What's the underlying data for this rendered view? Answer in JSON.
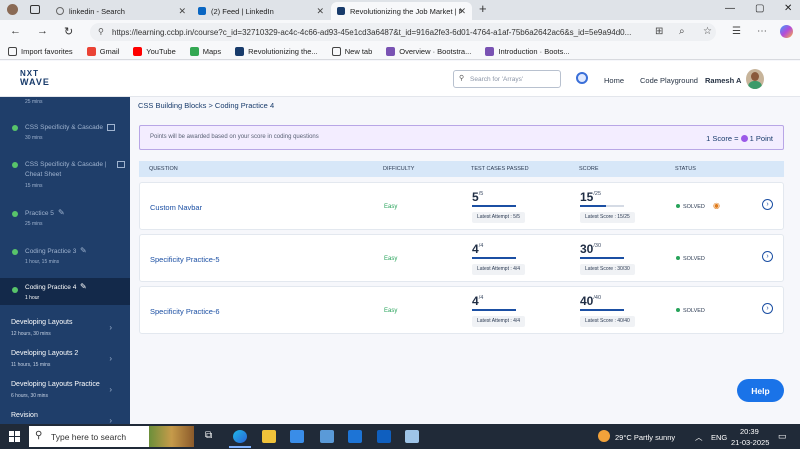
{
  "browser": {
    "tabs": [
      {
        "label": "linkedin - Search"
      },
      {
        "label": "(2) Feed | LinkedIn"
      },
      {
        "label": "Revolutionizing the Job Market | N"
      }
    ],
    "new_tab": "+",
    "url": "https://learning.ccbp.in/course?c_id=32710329-ac4c-4c66-ad93-45e1cd3a6487&t_id=916a2fe3-6d01-4764-a1af-75b6a2642ac6&s_id=5e9a94d0...",
    "bookmarks": [
      {
        "label": "Import favorites"
      },
      {
        "label": "Gmail"
      },
      {
        "label": "YouTube"
      },
      {
        "label": "Maps"
      },
      {
        "label": "Revolutionizing the..."
      },
      {
        "label": "New tab"
      },
      {
        "label": "Overview · Bootstra..."
      },
      {
        "label": "Introduction · Boots..."
      }
    ]
  },
  "header": {
    "logo_top": "NXT",
    "logo_bottom": "WAVE",
    "search_placeholder": "Search for 'Arrays'",
    "nav": {
      "home": "Home",
      "playground": "Code Playground",
      "user": "Ramesh A"
    }
  },
  "sidebar": {
    "items": [
      {
        "title": "",
        "time": "25 mins"
      },
      {
        "title": "CSS Specificity & Cascade",
        "time": "30 mins"
      },
      {
        "title": "CSS Specificity & Cascade | Cheat Sheet",
        "time": "15 mins"
      },
      {
        "title": "Practice 5",
        "time": "25 mins"
      },
      {
        "title": "Coding Practice 3",
        "time": "1 hour, 15 mins"
      },
      {
        "title": "Coding Practice 4",
        "time": "1 hour"
      }
    ],
    "sections": [
      {
        "title": "Developing Layouts",
        "time": "12 hours, 30 mins"
      },
      {
        "title": "Developing Layouts 2",
        "time": "11 hours, 15 mins"
      },
      {
        "title": "Developing Layouts Practice",
        "time": "6 hours, 30 mins"
      },
      {
        "title": "Revision",
        "time": ""
      }
    ]
  },
  "main": {
    "breadcrumb": "CSS Building Blocks > Coding Practice 4",
    "notice": "Points will be awarded based on your score in coding questions",
    "score_rule_left": "1 Score =",
    "score_rule_right": "1 Point",
    "columns": {
      "question": "QUESTION",
      "difficulty": "DIFFICULTY",
      "tests": "TEST CASES PASSED",
      "score": "SCORE",
      "status": "STATUS"
    },
    "rows": [
      {
        "question": "Custom Navbar",
        "difficulty": "Easy",
        "passed": "5",
        "total": "/5",
        "attempt": "Latest Attempt : 5/5",
        "score": "15",
        "score_total": "/25",
        "score_label": "Latest Score : 15/25",
        "score_fraction": 0.6,
        "status": "SOLVED"
      },
      {
        "question": "Specificity Practice-5",
        "difficulty": "Easy",
        "passed": "4",
        "total": "/4",
        "attempt": "Latest Attempt : 4/4",
        "score": "30",
        "score_total": "/30",
        "score_label": "Latest Score : 30/30",
        "score_fraction": 1.0,
        "status": "SOLVED"
      },
      {
        "question": "Specificity Practice-6",
        "difficulty": "Easy",
        "passed": "4",
        "total": "/4",
        "attempt": "Latest Attempt : 4/4",
        "score": "40",
        "score_total": "/40",
        "score_label": "Latest Score : 40/40",
        "score_fraction": 1.0,
        "status": "SOLVED"
      }
    ],
    "help": "Help"
  },
  "taskbar": {
    "search_placeholder": "Type here to search",
    "weather": "29°C  Partly sunny",
    "lang": "ENG",
    "time": "20:39",
    "date": "21-03-2025"
  },
  "colors": {
    "sidebar": "#1f3e6a",
    "accent": "#1a73e8",
    "solved": "#27a35a"
  }
}
